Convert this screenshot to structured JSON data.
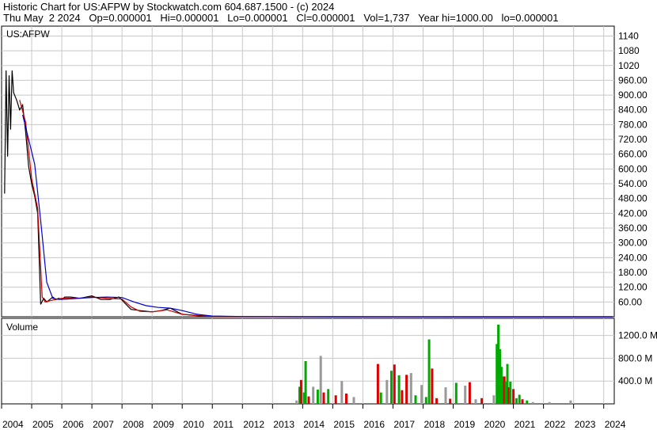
{
  "header": {
    "line1": "Historic Chart for US:AFPW by Stockwatch.com 604.687.1500 - (c) 2024",
    "line2": "Thu May  2 2024   Op=0.000001   Hi=0.000001   Lo=0.000001   Cl=0.000001   Vol=1,737   Year hi=1000.00   lo=0.000001"
  },
  "colors": {
    "price": "#000000",
    "ma_short": "#cc0000",
    "ma_long": "#0000cc",
    "volume_up": "#00aa00",
    "volume_down": "#dd0000",
    "volume_flat": "#999999",
    "grid": "#c8c8c8"
  },
  "chart_data": [
    {
      "type": "line",
      "title": "US:AFPW",
      "ylim": [
        0,
        1180
      ],
      "y_ticks": [
        "1140",
        "1080",
        "1020",
        "960.00",
        "900.00",
        "840.00",
        "780.00",
        "720.00",
        "660.00",
        "600.00",
        "540.00",
        "480.00",
        "420.00",
        "360.00",
        "300.00",
        "240.00",
        "180.00",
        "120.00",
        "60.00"
      ],
      "y_tick_values": [
        1140,
        1080,
        1020,
        960,
        900,
        840,
        780,
        720,
        660,
        600,
        540,
        480,
        420,
        360,
        300,
        240,
        180,
        120,
        60
      ],
      "x_ticks": [
        "2004",
        "2005",
        "2006",
        "2007",
        "2008",
        "2009",
        "2010",
        "2011",
        "2012",
        "2013",
        "2014",
        "2015",
        "2016",
        "2017",
        "2018",
        "2019",
        "2020",
        "2021",
        "2022",
        "2023",
        "2024"
      ],
      "x_tick_values": [
        2004,
        2005,
        2006,
        2007,
        2008,
        2009,
        2010,
        2011,
        2012,
        2013,
        2014,
        2015,
        2016,
        2017,
        2018,
        2019,
        2020,
        2021,
        2022,
        2023,
        2024
      ],
      "xlim": [
        2004.0,
        2024.35
      ],
      "series": [
        {
          "key": "price",
          "x": [
            2004.1,
            2004.15,
            2004.2,
            2004.25,
            2004.3,
            2004.35,
            2004.4,
            2004.5,
            2004.6,
            2004.7,
            2004.8,
            2004.9,
            2005.0,
            2005.1,
            2005.2,
            2005.3,
            2005.4,
            2005.5,
            2005.6,
            2005.7,
            2005.8,
            2005.9,
            2006.0,
            2006.1,
            2006.3,
            2006.6,
            2007.0,
            2007.3,
            2007.6,
            2007.9,
            2008.1,
            2008.3,
            2008.6,
            2009.0,
            2009.3,
            2009.6,
            2010.0,
            2010.5,
            2011.0,
            2012,
            2014,
            2016,
            2018,
            2020,
            2022,
            2024.3
          ],
          "y": [
            500,
            1000,
            650,
            980,
            760,
            1000,
            910,
            880,
            840,
            860,
            750,
            610,
            540,
            490,
            420,
            50,
            75,
            60,
            70,
            80,
            70,
            75,
            70,
            80,
            80,
            75,
            85,
            70,
            70,
            80,
            55,
            30,
            25,
            20,
            25,
            35,
            10,
            5,
            2,
            0.5,
            0.1,
            0.05,
            0.02,
            0.01,
            0.005,
            1e-06
          ]
        },
        {
          "key": "ma_short",
          "x": [
            2004.6,
            2004.8,
            2005.0,
            2005.2,
            2005.35,
            2005.45,
            2005.6,
            2005.8,
            2006.0,
            2006.5,
            2007.0,
            2007.5,
            2008.0,
            2008.3,
            2008.6,
            2009.0,
            2009.5,
            2010.0,
            2010.5,
            2011.0,
            2013,
            2016,
            2020,
            2024.3
          ],
          "y": [
            880,
            790,
            560,
            440,
            80,
            60,
            65,
            70,
            75,
            75,
            80,
            75,
            72,
            40,
            22,
            20,
            28,
            10,
            4,
            1,
            0.3,
            0.1,
            0.02,
            1e-06
          ]
        },
        {
          "key": "ma_long",
          "x": [
            2004.7,
            2004.9,
            2005.1,
            2005.3,
            2005.5,
            2005.7,
            2005.9,
            2006.2,
            2006.6,
            2007.0,
            2007.5,
            2008.0,
            2008.4,
            2008.8,
            2009.2,
            2009.6,
            2010.0,
            2010.5,
            2011.0,
            2012,
            2015,
            2020,
            2024.3
          ],
          "y": [
            820,
            720,
            620,
            390,
            140,
            75,
            70,
            72,
            75,
            78,
            80,
            78,
            60,
            45,
            38,
            35,
            25,
            10,
            3,
            1,
            0.3,
            0.05,
            1e-06
          ]
        }
      ]
    },
    {
      "type": "bar",
      "title": "Volume",
      "ylim": [
        0,
        1500
      ],
      "y_ticks": [
        "1200.0 M",
        "800.0 M",
        "400.0 M"
      ],
      "y_tick_values": [
        1200,
        800,
        400
      ],
      "xlim": [
        2004.0,
        2024.35
      ],
      "bars": [
        {
          "x": 2013.8,
          "v": 60,
          "c": "flat"
        },
        {
          "x": 2013.9,
          "v": 300,
          "c": "up"
        },
        {
          "x": 2013.95,
          "v": 420,
          "c": "down"
        },
        {
          "x": 2014.05,
          "v": 200,
          "c": "up"
        },
        {
          "x": 2014.1,
          "v": 750,
          "c": "up"
        },
        {
          "x": 2014.2,
          "v": 130,
          "c": "down"
        },
        {
          "x": 2014.35,
          "v": 300,
          "c": "flat"
        },
        {
          "x": 2014.5,
          "v": 250,
          "c": "up"
        },
        {
          "x": 2014.6,
          "v": 840,
          "c": "flat"
        },
        {
          "x": 2014.7,
          "v": 200,
          "c": "down"
        },
        {
          "x": 2014.85,
          "v": 260,
          "c": "up"
        },
        {
          "x": 2015.1,
          "v": 150,
          "c": "down"
        },
        {
          "x": 2015.3,
          "v": 400,
          "c": "flat"
        },
        {
          "x": 2015.45,
          "v": 180,
          "c": "down"
        },
        {
          "x": 2015.7,
          "v": 120,
          "c": "flat"
        },
        {
          "x": 2016.5,
          "v": 700,
          "c": "down"
        },
        {
          "x": 2016.6,
          "v": 200,
          "c": "up"
        },
        {
          "x": 2016.8,
          "v": 420,
          "c": "flat"
        },
        {
          "x": 2016.95,
          "v": 580,
          "c": "up"
        },
        {
          "x": 2017.05,
          "v": 690,
          "c": "down"
        },
        {
          "x": 2017.2,
          "v": 500,
          "c": "up"
        },
        {
          "x": 2017.3,
          "v": 240,
          "c": "down"
        },
        {
          "x": 2017.45,
          "v": 510,
          "c": "down"
        },
        {
          "x": 2017.6,
          "v": 540,
          "c": "flat"
        },
        {
          "x": 2017.75,
          "v": 150,
          "c": "up"
        },
        {
          "x": 2017.95,
          "v": 330,
          "c": "flat"
        },
        {
          "x": 2018.1,
          "v": 120,
          "c": "up"
        },
        {
          "x": 2018.2,
          "v": 1130,
          "c": "up"
        },
        {
          "x": 2018.3,
          "v": 620,
          "c": "down"
        },
        {
          "x": 2018.45,
          "v": 100,
          "c": "down"
        },
        {
          "x": 2018.75,
          "v": 290,
          "c": "flat"
        },
        {
          "x": 2018.9,
          "v": 90,
          "c": "down"
        },
        {
          "x": 2019.1,
          "v": 370,
          "c": "up"
        },
        {
          "x": 2019.4,
          "v": 320,
          "c": "flat"
        },
        {
          "x": 2019.55,
          "v": 380,
          "c": "down"
        },
        {
          "x": 2019.75,
          "v": 80,
          "c": "flat"
        },
        {
          "x": 2019.95,
          "v": 100,
          "c": "down"
        },
        {
          "x": 2020.35,
          "v": 150,
          "c": "flat"
        },
        {
          "x": 2020.45,
          "v": 1050,
          "c": "up"
        },
        {
          "x": 2020.5,
          "v": 1390,
          "c": "up"
        },
        {
          "x": 2020.55,
          "v": 960,
          "c": "up"
        },
        {
          "x": 2020.6,
          "v": 650,
          "c": "up"
        },
        {
          "x": 2020.65,
          "v": 480,
          "c": "up"
        },
        {
          "x": 2020.7,
          "v": 480,
          "c": "down"
        },
        {
          "x": 2020.75,
          "v": 390,
          "c": "up"
        },
        {
          "x": 2020.8,
          "v": 700,
          "c": "up"
        },
        {
          "x": 2020.85,
          "v": 290,
          "c": "down"
        },
        {
          "x": 2020.9,
          "v": 390,
          "c": "up"
        },
        {
          "x": 2021.0,
          "v": 260,
          "c": "down"
        },
        {
          "x": 2021.1,
          "v": 100,
          "c": "up"
        },
        {
          "x": 2021.2,
          "v": 160,
          "c": "up"
        },
        {
          "x": 2021.3,
          "v": 80,
          "c": "down"
        },
        {
          "x": 2021.45,
          "v": 60,
          "c": "up"
        },
        {
          "x": 2021.65,
          "v": 30,
          "c": "flat"
        },
        {
          "x": 2022.2,
          "v": 30,
          "c": "flat"
        },
        {
          "x": 2022.9,
          "v": 60,
          "c": "flat"
        }
      ]
    }
  ]
}
